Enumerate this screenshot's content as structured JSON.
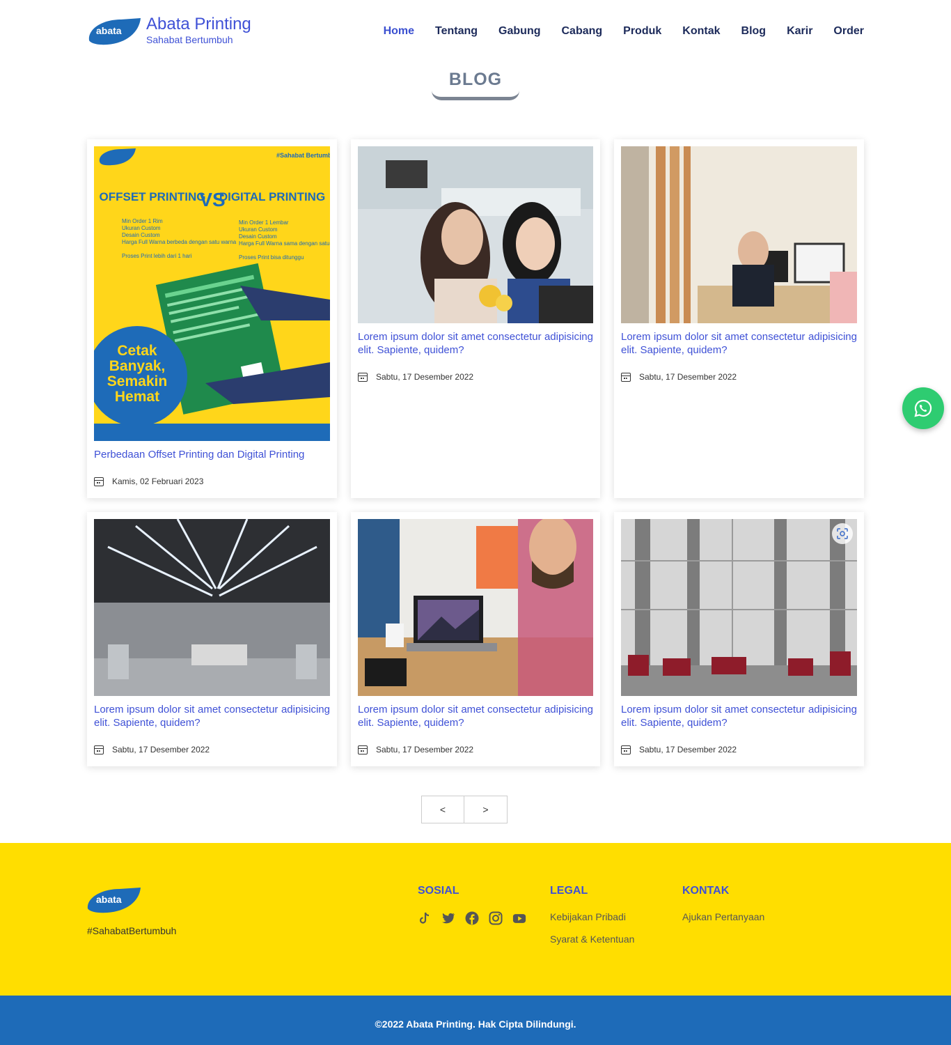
{
  "header": {
    "brand_title": "Abata Printing",
    "brand_subtitle": "Sahabat Bertumbuh",
    "logo_text": "abata",
    "nav": [
      "Home",
      "Tentang",
      "Gabung",
      "Cabang",
      "Produk",
      "Kontak",
      "Blog",
      "Karir",
      "Order"
    ],
    "active": "Home"
  },
  "section": {
    "title": "BLOG"
  },
  "posts": [
    {
      "title": "Perbedaan Offset Printing dan Digital Printing",
      "date": "Kamis, 02 Februari 2023"
    },
    {
      "title": "Lorem ipsum dolor sit amet consectetur adipisicing elit. Sapiente, quidem?",
      "date": "Sabtu, 17 Desember 2022"
    },
    {
      "title": "Lorem ipsum dolor sit amet consectetur adipisicing elit. Sapiente, quidem?",
      "date": "Sabtu, 17 Desember 2022"
    },
    {
      "title": "Lorem ipsum dolor sit amet consectetur adipisicing elit. Sapiente, quidem?",
      "date": "Sabtu, 17 Desember 2022"
    },
    {
      "title": "Lorem ipsum dolor sit amet consectetur adipisicing elit. Sapiente, quidem?",
      "date": "Sabtu, 17 Desember 2022"
    },
    {
      "title": "Lorem ipsum dolor sit amet consectetur adipisicing elit. Sapiente, quidem?",
      "date": "Sabtu, 17 Desember 2022"
    }
  ],
  "poster": {
    "hashtag": "#Sahabat Bertumbuh",
    "left_title": "OFFSET PRINTING",
    "right_title": "DIGITAL PRINTING",
    "vs": "VS",
    "left_points": [
      "Min Order 1 Rim",
      "Ukuran Custom",
      "Desain Custom",
      "Harga Full Warna berbeda dengan satu warna",
      "Proses Print lebih dari 1 hari"
    ],
    "right_points": [
      "Min Order 1 Lembar",
      "Ukuran Custom",
      "Desain Custom",
      "Harga Full Warna sama dengan satu warna",
      "Proses Print bisa ditunggu"
    ],
    "circle_text": "Cetak Banyak, Semakin Hemat"
  },
  "pager": {
    "prev": "<",
    "next": ">"
  },
  "footer": {
    "hashtag": "#SahabatBertumbuh",
    "sosial": {
      "title": "SOSIAL",
      "icons": [
        "tiktok-icon",
        "twitter-icon",
        "facebook-icon",
        "instagram-icon",
        "youtube-icon"
      ]
    },
    "legal": {
      "title": "LEGAL",
      "links": [
        "Kebijakan Pribadi",
        "Syarat & Ketentuan"
      ]
    },
    "kontak": {
      "title": "KONTAK",
      "links": [
        "Ajukan Pertanyaan"
      ]
    },
    "copyright": "©2022 Abata Printing. Hak Cipta Dilindungi."
  },
  "colors": {
    "accent": "#3f51d6",
    "nav": "#1c2a5a",
    "footer_bg": "#ffde00",
    "copyright_bg": "#1e6bb8",
    "whatsapp": "#2ecc71"
  }
}
